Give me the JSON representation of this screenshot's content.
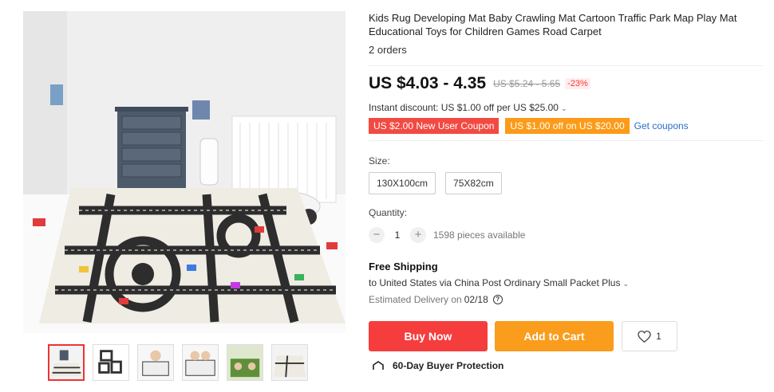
{
  "product": {
    "title": "Kids Rug Developing Mat Baby Crawling Mat Cartoon Traffic Park Map Play Mat Educational Toys for Children Games Road Carpet",
    "orders": "2 orders",
    "price": "US $4.03 - 4.35",
    "original_price": "US $5.24 - 5.65",
    "discount": "-23%"
  },
  "promotions": {
    "instant_discount": "Instant discount: US $1.00 off per US $25.00",
    "new_user_coupon": "US $2.00 New User Coupon",
    "store_coupon": "US $1.00 off on US $20.00",
    "get_coupons": "Get coupons"
  },
  "size": {
    "label": "Size:",
    "options": [
      "130X100cm",
      "75X82cm"
    ]
  },
  "quantity": {
    "label": "Quantity:",
    "value": "1",
    "decrement": "−",
    "increment": "+",
    "available": "1598 pieces available"
  },
  "shipping": {
    "title": "Free Shipping",
    "destination": "to United States via China Post Ordinary Small Packet Plus",
    "delivery_label": "Estimated Delivery on",
    "delivery_date": "02/18"
  },
  "actions": {
    "buy_now": "Buy Now",
    "add_to_cart": "Add to Cart",
    "wishlist_count": "1"
  },
  "protection": {
    "label": "60-Day Buyer Protection"
  },
  "colors": {
    "accent_red": "#f53d3d",
    "accent_orange": "#fa9c1c",
    "link": "#2a6ec9"
  },
  "icons": [
    "chevron-down-icon",
    "help-circle-icon",
    "heart-icon",
    "shield-icon"
  ]
}
